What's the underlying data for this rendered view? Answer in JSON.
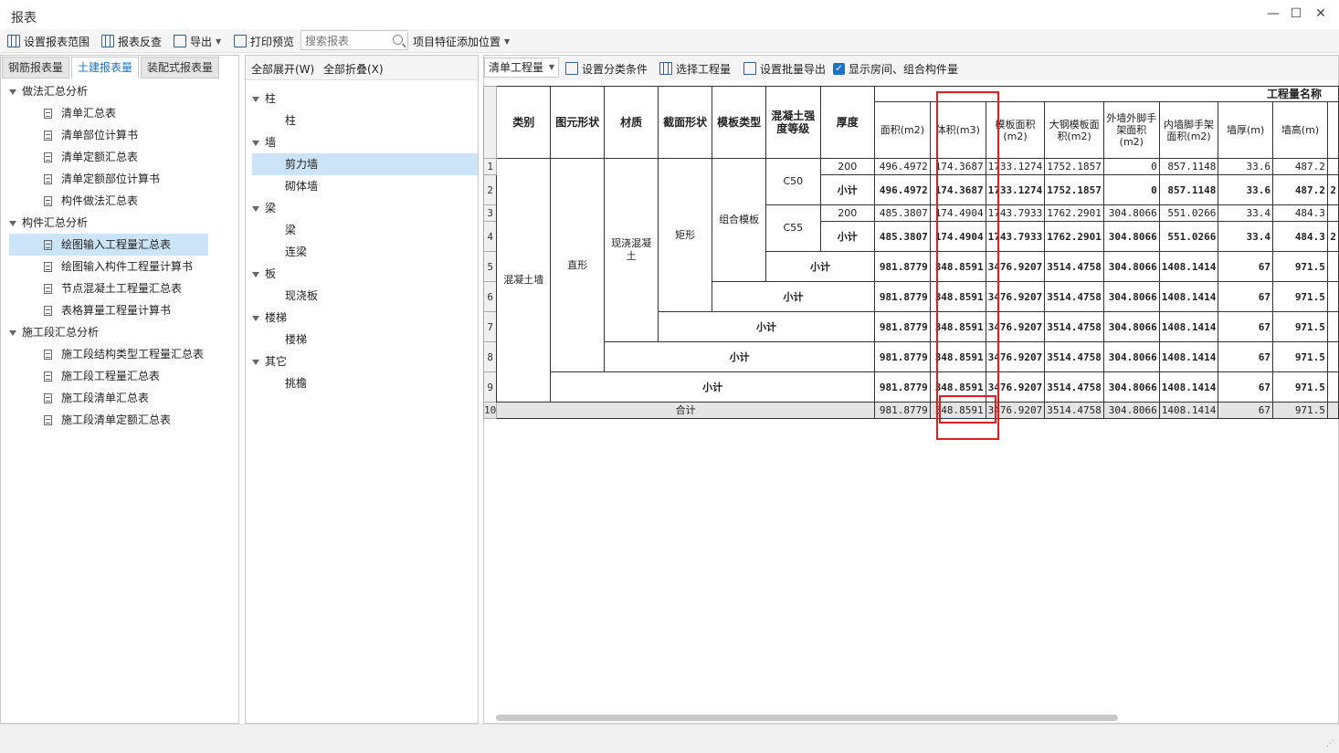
{
  "window": {
    "title": "报表",
    "controls": [
      "—",
      "☐",
      "✕"
    ]
  },
  "toolbar": {
    "set_range": "设置报表范围",
    "reverse_check": "报表反查",
    "export": "导出",
    "print_preview": "打印预览",
    "search_placeholder": "搜索报表",
    "feature_position": "项目特征添加位置"
  },
  "left": {
    "tabs": [
      "钢筋报表量",
      "土建报表量",
      "装配式报表量"
    ],
    "active_tab": 1,
    "groups": [
      {
        "label": "做法汇总分析",
        "items": [
          "清单汇总表",
          "清单部位计算书",
          "清单定额汇总表",
          "清单定额部位计算书",
          "构件做法汇总表"
        ]
      },
      {
        "label": "构件汇总分析",
        "items": [
          "绘图输入工程量汇总表",
          "绘图输入构件工程量计算书",
          "节点混凝土工程量汇总表",
          "表格算量工程量计算书"
        ]
      },
      {
        "label": "施工段汇总分析",
        "items": [
          "施工段结构类型工程量汇总表",
          "施工段工程量汇总表",
          "施工段清单汇总表",
          "施工段清单定额汇总表"
        ]
      }
    ],
    "selected_item": "绘图输入工程量汇总表"
  },
  "middle": {
    "expand_all": "全部展开(W)",
    "collapse_all": "全部折叠(X)",
    "tree": [
      {
        "label": "柱",
        "children": [
          "柱"
        ]
      },
      {
        "label": "墙",
        "children": [
          "剪力墙",
          "砌体墙"
        ]
      },
      {
        "label": "梁",
        "children": [
          "梁",
          "连梁"
        ]
      },
      {
        "label": "板",
        "children": [
          "现浇板"
        ]
      },
      {
        "label": "楼梯",
        "children": [
          "楼梯"
        ]
      },
      {
        "label": "其它",
        "children": [
          "挑檐"
        ]
      }
    ],
    "selected_item": "剪力墙"
  },
  "right": {
    "dropdown_value": "清单工程量",
    "set_category": "设置分类条件",
    "select_quantity": "选择工程量",
    "batch_export": "设置批量导出",
    "show_rooms": "显示房间、组合构件量",
    "show_rooms_checked": true
  },
  "report": {
    "group_header": "工程量名称",
    "headers": [
      "类别",
      "图元形状",
      "材质",
      "截面形状",
      "模板类型",
      "混凝土强度等级",
      "厚度"
    ],
    "qty_headers": [
      "面积(m2)",
      "体积(m3)",
      "模板面积(m2)",
      "大钢模板面积(m2)",
      "外墙外脚手架面积(m2)",
      "内墙脚手架面积(m2)",
      "墙厚(m)",
      "墙高(m)"
    ],
    "merged": {
      "category": "混凝土墙",
      "shape": "直形",
      "material": "现浇混凝土",
      "section": "矩形",
      "formwork": "组合模板",
      "grade_1": "C50",
      "grade_2": "C55"
    },
    "subtotal_label": "小计",
    "total_label": "合计",
    "rows": [
      {
        "num": "1",
        "thick": "200",
        "v": [
          "496.4972",
          "174.3687",
          "1733.1274",
          "1752.1857",
          "0",
          "857.1148",
          "33.6",
          "487.2"
        ]
      },
      {
        "num": "2",
        "thick": "小计",
        "v": [
          "496.4972",
          "174.3687",
          "1733.1274",
          "1752.1857",
          "0",
          "857.1148",
          "33.6",
          "487.2"
        ]
      },
      {
        "num": "3",
        "thick": "200",
        "v": [
          "485.3807",
          "174.4904",
          "1743.7933",
          "1762.2901",
          "304.8066",
          "551.0266",
          "33.4",
          "484.3"
        ]
      },
      {
        "num": "4",
        "thick": "小计",
        "v": [
          "485.3807",
          "174.4904",
          "1743.7933",
          "1762.2901",
          "304.8066",
          "551.0266",
          "33.4",
          "484.3"
        ]
      },
      {
        "num": "5",
        "v": [
          "981.8779",
          "348.8591",
          "3476.9207",
          "3514.4758",
          "304.8066",
          "1408.1414",
          "67",
          "971.5"
        ]
      },
      {
        "num": "6",
        "v": [
          "981.8779",
          "348.8591",
          "3476.9207",
          "3514.4758",
          "304.8066",
          "1408.1414",
          "67",
          "971.5"
        ]
      },
      {
        "num": "7",
        "v": [
          "981.8779",
          "348.8591",
          "3476.9207",
          "3514.4758",
          "304.8066",
          "1408.1414",
          "67",
          "971.5"
        ]
      },
      {
        "num": "8",
        "v": [
          "981.8779",
          "348.8591",
          "3476.9207",
          "3514.4758",
          "304.8066",
          "1408.1414",
          "67",
          "971.5"
        ]
      },
      {
        "num": "9",
        "v": [
          "981.8779",
          "348.8591",
          "3476.9207",
          "3514.4758",
          "304.8066",
          "1408.1414",
          "67",
          "971.5"
        ]
      },
      {
        "num": "10",
        "v": [
          "981.8779",
          "348.8591",
          "3476.9207",
          "3514.4758",
          "304.8066",
          "1408.1414",
          "67",
          "971.5"
        ]
      }
    ],
    "edge_char": "2"
  },
  "colors": {
    "accent": "#1a73c8",
    "highlight": "#e02020",
    "selection": "#cce4f7"
  }
}
